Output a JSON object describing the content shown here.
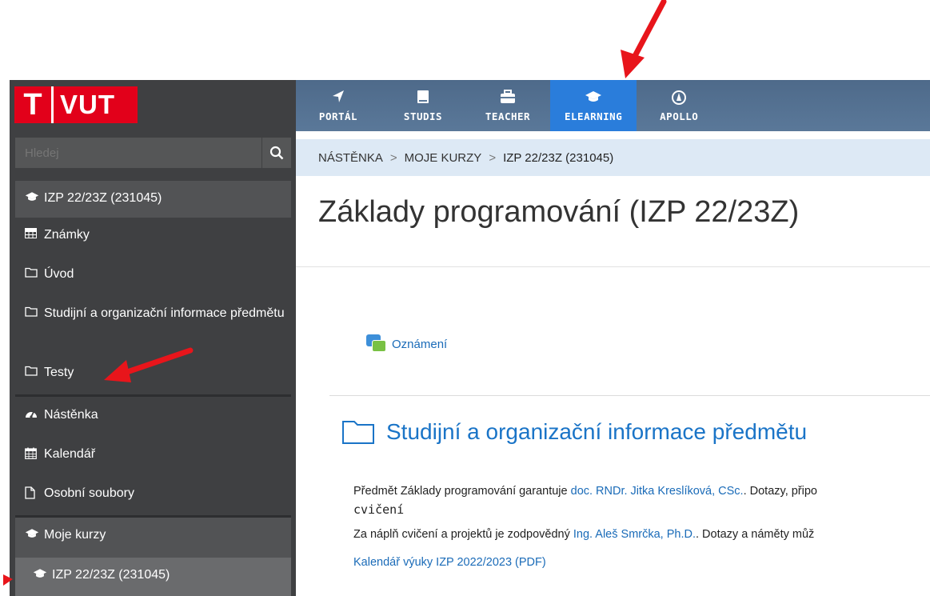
{
  "brand": {
    "letter": "T",
    "name": "VUT"
  },
  "nav": {
    "items": [
      {
        "label": "PORTÁL",
        "icon": "navigation-arrow-icon",
        "glyph": "➤"
      },
      {
        "label": "STUDIS",
        "icon": "book-icon",
        "glyph": "▮"
      },
      {
        "label": "TEACHER",
        "icon": "briefcase-icon",
        "glyph": "▬"
      },
      {
        "label": "ELEARNING",
        "icon": "graduation-cap-icon",
        "glyph": "🎓"
      },
      {
        "label": "APOLLO",
        "icon": "apollo-logo-icon",
        "glyph": "◉"
      }
    ],
    "active": "ELEARNING"
  },
  "sidebar": {
    "search_placeholder": "Hledej",
    "course_header": "IZP 22/23Z (231045)",
    "course_items": [
      {
        "label": "Známky",
        "icon": "table-icon"
      },
      {
        "label": "Úvod",
        "icon": "folder-icon"
      },
      {
        "label": "Studijní a organizační informace předmětu",
        "icon": "folder-icon"
      },
      {
        "label": "Testy",
        "icon": "folder-icon"
      }
    ],
    "general_items": [
      {
        "label": "Nástěnka",
        "icon": "dashboard-icon"
      },
      {
        "label": "Kalendář",
        "icon": "calendar-icon"
      },
      {
        "label": "Osobní soubory",
        "icon": "file-icon"
      }
    ],
    "my_courses": {
      "label": "Moje kurzy",
      "icon": "graduation-cap-icon"
    },
    "my_course_item": {
      "label": "IZP 22/23Z (231045)",
      "icon": "graduation-cap-icon"
    }
  },
  "breadcrumb": {
    "items": [
      "NÁSTĚNKA",
      "MOJE KURZY",
      "IZP 22/23Z (231045)"
    ],
    "separator": ">"
  },
  "main": {
    "title": "Základy programování (IZP 22/23Z)",
    "forum_label": "Oznámení",
    "section_title": "Studijní a organizační informace předmětu",
    "para1_prefix": "Předmět Základy programování garantuje ",
    "para1_link": "doc. RNDr. Jitka Kreslíková, CSc.",
    "para1_suffix": ". Dotazy, připo",
    "para1_mono": "cvičení",
    "para2_prefix": "Za náplň cvičení a projektů je zodpovědný ",
    "para2_link": "Ing. Aleš Smrčka, Ph.D.",
    "para2_suffix": ". Dotazy a náměty můž",
    "calendar_link": "Kalendář výuky IZP 2022/2023 (PDF)"
  },
  "colors": {
    "accent": "#2a7ddb",
    "brand_red": "#e2001a",
    "sidebar_bg": "#3f4042",
    "annotation_arrow": "#e8151b",
    "link": "#1a6bb8"
  }
}
